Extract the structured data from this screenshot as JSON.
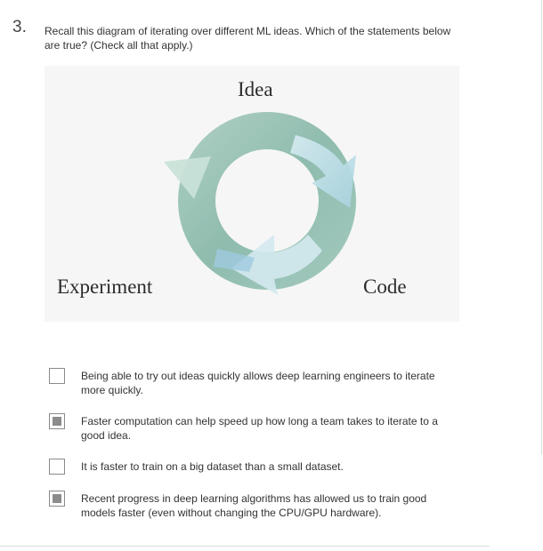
{
  "question": {
    "number": "3.",
    "prompt": "Recall this diagram of iterating over different ML ideas. Which of the statements below are true? (Check all that apply.)"
  },
  "diagram": {
    "top_label": "Idea",
    "left_label": "Experiment",
    "right_label": "Code"
  },
  "options": [
    {
      "text": "Being able to try out ideas quickly allows deep learning engineers to iterate more quickly.",
      "checked": false
    },
    {
      "text": "Faster computation can help speed up how long a team takes to iterate to a good idea.",
      "checked": true
    },
    {
      "text": "It is faster to train on a big dataset than a small dataset.",
      "checked": false
    },
    {
      "text": "Recent progress in deep learning algorithms has allowed us to train good models faster (even without changing the CPU/GPU hardware).",
      "checked": true
    }
  ]
}
